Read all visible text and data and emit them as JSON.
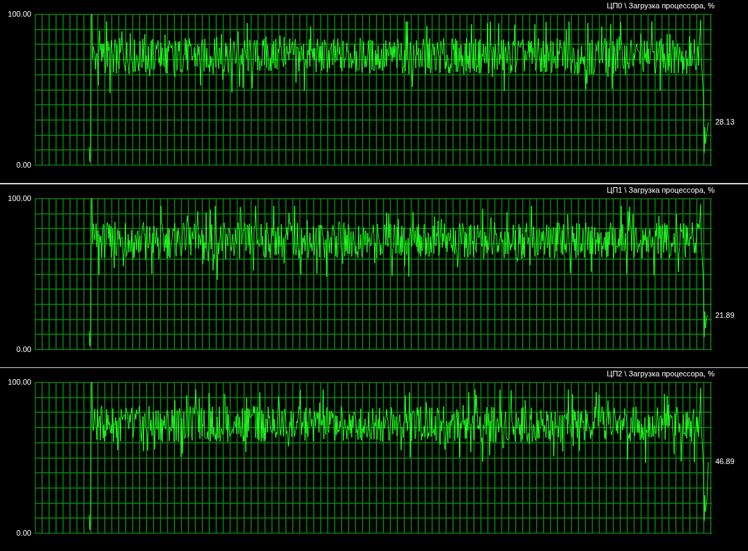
{
  "panels": [
    {
      "title": "ЦП0 \\ Загрузка процессора, %",
      "y_max_label": "100.00",
      "y_min_label": "0.00",
      "current_value": "28.13"
    },
    {
      "title": "ЦП1 \\ Загрузка процессора, %",
      "y_max_label": "100.00",
      "y_min_label": "0.00",
      "current_value": "21.89"
    },
    {
      "title": "ЦП2 \\ Загрузка процессора, %",
      "y_max_label": "100.00",
      "y_min_label": "0.00",
      "current_value": "46.89"
    }
  ]
}
